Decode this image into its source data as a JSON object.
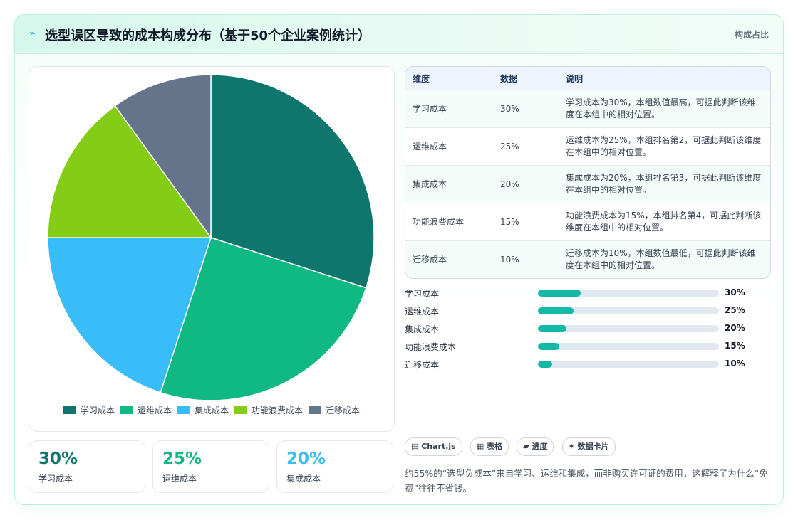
{
  "header": {
    "icon": "⌁",
    "title": "选型误区导致的成本构成分布（基于50个企业案例统计）",
    "right_label": "构成占比"
  },
  "chart_data": {
    "type": "pie",
    "categories": [
      "学习成本",
      "运维成本",
      "集成成本",
      "功能浪费成本",
      "迁移成本"
    ],
    "values": [
      30,
      25,
      20,
      15,
      10
    ],
    "colors": [
      "#0f766e",
      "#10b981",
      "#38bdf8",
      "#84cc16",
      "#64748b"
    ],
    "legend_position": "bottom"
  },
  "kpis": [
    {
      "value": "30%",
      "label": "学习成本",
      "color": "#0f766e"
    },
    {
      "value": "25%",
      "label": "运维成本",
      "color": "#10b981"
    },
    {
      "value": "20%",
      "label": "集成成本",
      "color": "#38bdf8"
    }
  ],
  "table": {
    "headers": [
      "维度",
      "数据",
      "说明"
    ],
    "rows": [
      {
        "dim": "学习成本",
        "val": "30%",
        "desc": "学习成本为30%，本组数值最高，可据此判断该维度在本组中的相对位置。"
      },
      {
        "dim": "运维成本",
        "val": "25%",
        "desc": "运维成本为25%，本组排名第2，可据此判断该维度在本组中的相对位置。"
      },
      {
        "dim": "集成成本",
        "val": "20%",
        "desc": "集成成本为20%，本组排名第3，可据此判断该维度在本组中的相对位置。"
      },
      {
        "dim": "功能浪费成本",
        "val": "15%",
        "desc": "功能浪费成本为15%，本组排名第4，可据此判断该维度在本组中的相对位置。"
      },
      {
        "dim": "迁移成本",
        "val": "10%",
        "desc": "迁移成本为10%，本组数值最低，可据此判断该维度在本组中的相对位置。"
      }
    ]
  },
  "bars": [
    {
      "label": "学习成本",
      "value": "30%",
      "fraction": 0.3
    },
    {
      "label": "运维成本",
      "value": "25%",
      "fraction": 0.25
    },
    {
      "label": "集成成本",
      "value": "20%",
      "fraction": 0.2
    },
    {
      "label": "功能浪费成本",
      "value": "15%",
      "fraction": 0.15
    },
    {
      "label": "迁移成本",
      "value": "10%",
      "fraction": 0.1
    }
  ],
  "tags": [
    "▤ Chart.js",
    "▦ 表格",
    "▰ 进度",
    "✦ 数据卡片"
  ],
  "note": "约55%的“选型负成本”来自学习、运维和集成，而非购买许可证的费用，这解释了为什么“免费”往往不省钱。"
}
